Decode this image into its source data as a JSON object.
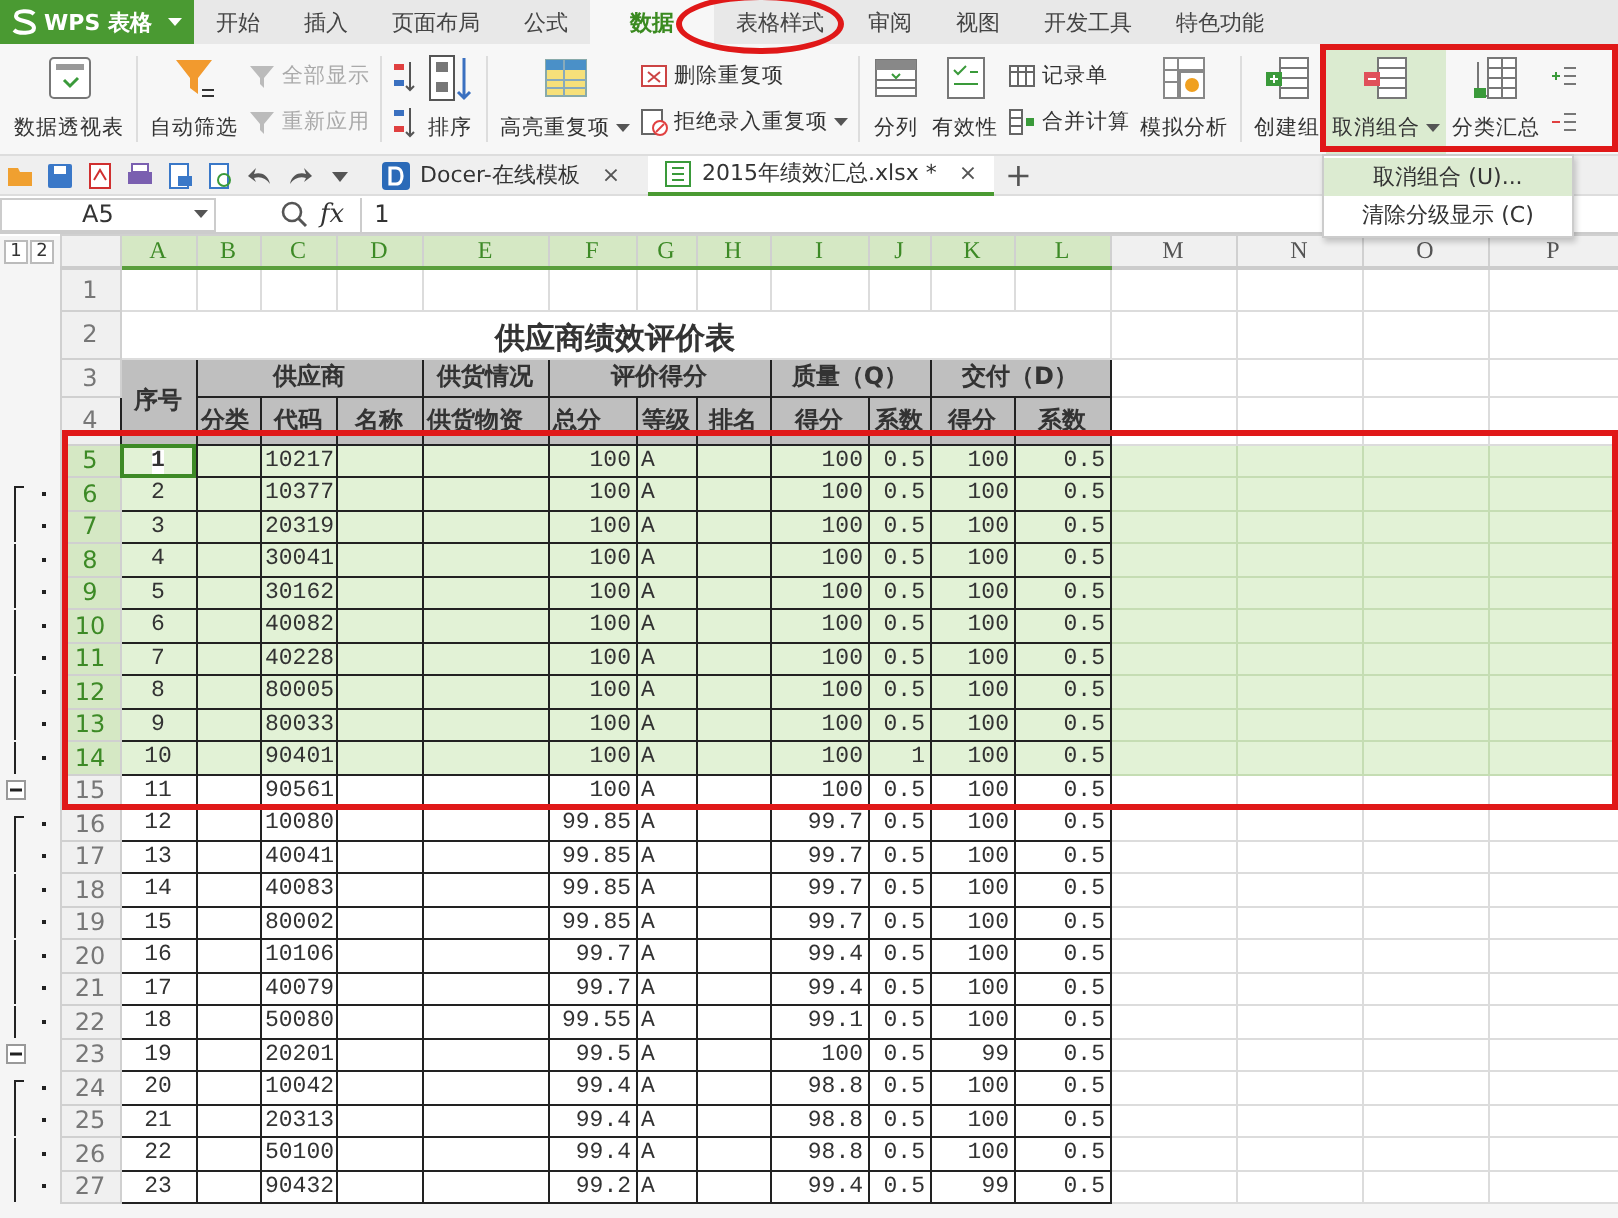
{
  "app": {
    "logo": "WPS 表格",
    "menu_tabs": [
      {
        "label": "开始",
        "selected": false
      },
      {
        "label": "插入",
        "selected": false
      },
      {
        "label": "页面布局",
        "selected": false
      },
      {
        "label": "公式",
        "selected": false
      },
      {
        "label": "数据",
        "selected": true
      },
      {
        "label": "表格样式",
        "selected": false
      },
      {
        "label": "审阅",
        "selected": false
      },
      {
        "label": "视图",
        "selected": false
      },
      {
        "label": "开发工具",
        "selected": false
      },
      {
        "label": "特色功能",
        "selected": false
      }
    ]
  },
  "ribbon": [
    {
      "kind": "large",
      "label": "数据透视表",
      "dropdown": false,
      "pressed": false
    },
    {
      "kind": "separator"
    },
    {
      "kind": "large",
      "label": "自动筛选",
      "dropdown": false,
      "pressed": false
    },
    {
      "kind": "stack",
      "items": [
        {
          "label": "全部显示",
          "disabled": true,
          "dropdown": false
        },
        {
          "label": "重新应用",
          "disabled": true,
          "dropdown": false
        }
      ]
    },
    {
      "kind": "separator"
    },
    {
      "kind": "sort",
      "label": "排序"
    },
    {
      "kind": "separator"
    },
    {
      "kind": "large",
      "label": "高亮重复项",
      "dropdown": true,
      "pressed": false
    },
    {
      "kind": "stack",
      "items": [
        {
          "label": "删除重复项",
          "disabled": false,
          "dropdown": false
        },
        {
          "label": "拒绝录入重复项",
          "disabled": false,
          "dropdown": true
        }
      ]
    },
    {
      "kind": "separator"
    },
    {
      "kind": "large",
      "label": "分列",
      "dropdown": false,
      "pressed": false
    },
    {
      "kind": "large",
      "label": "有效性",
      "dropdown": false,
      "pressed": false
    },
    {
      "kind": "stack",
      "items": [
        {
          "label": "记录单",
          "disabled": false,
          "dropdown": false
        },
        {
          "label": "合并计算",
          "disabled": false,
          "dropdown": false
        }
      ]
    },
    {
      "kind": "large",
      "label": "模拟分析",
      "dropdown": false,
      "pressed": false
    },
    {
      "kind": "separator"
    },
    {
      "kind": "large",
      "label": "创建组",
      "dropdown": false,
      "pressed": false
    },
    {
      "kind": "large",
      "label": "取消组合",
      "dropdown": true,
      "pressed": true
    },
    {
      "kind": "large",
      "label": "分类汇总",
      "dropdown": false,
      "pressed": false
    },
    {
      "kind": "detail"
    }
  ],
  "dropdown_menu": [
    {
      "label": "取消组合 (U)...",
      "selected": true
    },
    {
      "label": "清除分级显示 (C)",
      "selected": false
    }
  ],
  "doc_tabs": [
    {
      "label": "Docer-在线模板",
      "selected": false,
      "close": "×"
    },
    {
      "label": "2015年绩效汇总.xlsx *",
      "selected": true,
      "close": "×"
    }
  ],
  "new_tab": "+",
  "formula_bar": {
    "name_box": "A5",
    "fx": "fx",
    "value": "1"
  },
  "sheet": {
    "outline_levels": [
      "1",
      "2"
    ],
    "columns": [
      {
        "label": "A",
        "selected": true
      },
      {
        "label": "B",
        "selected": true
      },
      {
        "label": "C",
        "selected": true
      },
      {
        "label": "D",
        "selected": true
      },
      {
        "label": "E",
        "selected": true
      },
      {
        "label": "F",
        "selected": true
      },
      {
        "label": "G",
        "selected": true
      },
      {
        "label": "H",
        "selected": true
      },
      {
        "label": "I",
        "selected": true
      },
      {
        "label": "J",
        "selected": true
      },
      {
        "label": "K",
        "selected": true
      },
      {
        "label": "L",
        "selected": true
      },
      {
        "label": "M",
        "selected": false
      },
      {
        "label": "N",
        "selected": false
      },
      {
        "label": "O",
        "selected": false
      },
      {
        "label": "P",
        "selected": false
      }
    ],
    "top_rows": [
      {
        "number": "1",
        "selected": false
      },
      {
        "number": "2",
        "selected": false,
        "title": "供应商绩效评价表"
      }
    ],
    "header_rows": [
      {
        "number": "3",
        "selected": false
      },
      {
        "number": "4",
        "selected": false
      }
    ],
    "header_groups": [
      {
        "label": "序号"
      },
      {
        "label": "供应商",
        "columns": [
          "分类",
          "代码",
          "名称"
        ]
      },
      {
        "label": "供货情况",
        "columns": [
          "供货物资"
        ]
      },
      {
        "label": "评价得分",
        "columns": [
          "总分",
          "等级",
          "排名"
        ]
      },
      {
        "label": "质量（Q）",
        "columns": [
          "得分",
          "系数"
        ]
      },
      {
        "label": "交付（D）",
        "columns": [
          "得分",
          "系数"
        ]
      }
    ],
    "rows": [
      {
        "number": "5",
        "selected": true,
        "active": true,
        "grouped": false,
        "collapse": false,
        "no": "1",
        "code": "10217",
        "total": "100",
        "grade": "A",
        "q_score": "100",
        "q_coef": "0.5",
        "d_score": "100",
        "d_coef": "0.5"
      },
      {
        "number": "6",
        "selected": true,
        "active": false,
        "grouped": true,
        "collapse": false,
        "no": "2",
        "code": "10377",
        "total": "100",
        "grade": "A",
        "q_score": "100",
        "q_coef": "0.5",
        "d_score": "100",
        "d_coef": "0.5"
      },
      {
        "number": "7",
        "selected": true,
        "active": false,
        "grouped": true,
        "collapse": false,
        "no": "3",
        "code": "20319",
        "total": "100",
        "grade": "A",
        "q_score": "100",
        "q_coef": "0.5",
        "d_score": "100",
        "d_coef": "0.5"
      },
      {
        "number": "8",
        "selected": true,
        "active": false,
        "grouped": true,
        "collapse": false,
        "no": "4",
        "code": "30041",
        "total": "100",
        "grade": "A",
        "q_score": "100",
        "q_coef": "0.5",
        "d_score": "100",
        "d_coef": "0.5"
      },
      {
        "number": "9",
        "selected": true,
        "active": false,
        "grouped": true,
        "collapse": false,
        "no": "5",
        "code": "30162",
        "total": "100",
        "grade": "A",
        "q_score": "100",
        "q_coef": "0.5",
        "d_score": "100",
        "d_coef": "0.5"
      },
      {
        "number": "10",
        "selected": true,
        "active": false,
        "grouped": true,
        "collapse": false,
        "no": "6",
        "code": "40082",
        "total": "100",
        "grade": "A",
        "q_score": "100",
        "q_coef": "0.5",
        "d_score": "100",
        "d_coef": "0.5"
      },
      {
        "number": "11",
        "selected": true,
        "active": false,
        "grouped": true,
        "collapse": false,
        "no": "7",
        "code": "40228",
        "total": "100",
        "grade": "A",
        "q_score": "100",
        "q_coef": "0.5",
        "d_score": "100",
        "d_coef": "0.5"
      },
      {
        "number": "12",
        "selected": true,
        "active": false,
        "grouped": true,
        "collapse": false,
        "no": "8",
        "code": "80005",
        "total": "100",
        "grade": "A",
        "q_score": "100",
        "q_coef": "0.5",
        "d_score": "100",
        "d_coef": "0.5"
      },
      {
        "number": "13",
        "selected": true,
        "active": false,
        "grouped": true,
        "collapse": false,
        "no": "9",
        "code": "80033",
        "total": "100",
        "grade": "A",
        "q_score": "100",
        "q_coef": "0.5",
        "d_score": "100",
        "d_coef": "0.5"
      },
      {
        "number": "14",
        "selected": true,
        "active": false,
        "grouped": true,
        "collapse": false,
        "no": "10",
        "code": "90401",
        "total": "100",
        "grade": "A",
        "q_score": "100",
        "q_coef": "1",
        "d_score": "100",
        "d_coef": "0.5"
      },
      {
        "number": "15",
        "selected": false,
        "active": false,
        "grouped": false,
        "collapse": true,
        "no": "11",
        "code": "90561",
        "total": "100",
        "grade": "A",
        "q_score": "100",
        "q_coef": "0.5",
        "d_score": "100",
        "d_coef": "0.5"
      },
      {
        "number": "16",
        "selected": false,
        "active": false,
        "grouped": true,
        "collapse": false,
        "no": "12",
        "code": "10080",
        "total": "99.85",
        "grade": "A",
        "q_score": "99.7",
        "q_coef": "0.5",
        "d_score": "100",
        "d_coef": "0.5"
      },
      {
        "number": "17",
        "selected": false,
        "active": false,
        "grouped": true,
        "collapse": false,
        "no": "13",
        "code": "40041",
        "total": "99.85",
        "grade": "A",
        "q_score": "99.7",
        "q_coef": "0.5",
        "d_score": "100",
        "d_coef": "0.5"
      },
      {
        "number": "18",
        "selected": false,
        "active": false,
        "grouped": true,
        "collapse": false,
        "no": "14",
        "code": "40083",
        "total": "99.85",
        "grade": "A",
        "q_score": "99.7",
        "q_coef": "0.5",
        "d_score": "100",
        "d_coef": "0.5"
      },
      {
        "number": "19",
        "selected": false,
        "active": false,
        "grouped": true,
        "collapse": false,
        "no": "15",
        "code": "80002",
        "total": "99.85",
        "grade": "A",
        "q_score": "99.7",
        "q_coef": "0.5",
        "d_score": "100",
        "d_coef": "0.5"
      },
      {
        "number": "20",
        "selected": false,
        "active": false,
        "grouped": true,
        "collapse": false,
        "no": "16",
        "code": "10106",
        "total": "99.7",
        "grade": "A",
        "q_score": "99.4",
        "q_coef": "0.5",
        "d_score": "100",
        "d_coef": "0.5"
      },
      {
        "number": "21",
        "selected": false,
        "active": false,
        "grouped": true,
        "collapse": false,
        "no": "17",
        "code": "40079",
        "total": "99.7",
        "grade": "A",
        "q_score": "99.4",
        "q_coef": "0.5",
        "d_score": "100",
        "d_coef": "0.5"
      },
      {
        "number": "22",
        "selected": false,
        "active": false,
        "grouped": true,
        "collapse": false,
        "no": "18",
        "code": "50080",
        "total": "99.55",
        "grade": "A",
        "q_score": "99.1",
        "q_coef": "0.5",
        "d_score": "100",
        "d_coef": "0.5"
      },
      {
        "number": "23",
        "selected": false,
        "active": false,
        "grouped": false,
        "collapse": true,
        "no": "19",
        "code": "20201",
        "total": "99.5",
        "grade": "A",
        "q_score": "100",
        "q_coef": "0.5",
        "d_score": "99",
        "d_coef": "0.5"
      },
      {
        "number": "24",
        "selected": false,
        "active": false,
        "grouped": true,
        "collapse": false,
        "no": "20",
        "code": "10042",
        "total": "99.4",
        "grade": "A",
        "q_score": "98.8",
        "q_coef": "0.5",
        "d_score": "100",
        "d_coef": "0.5"
      },
      {
        "number": "25",
        "selected": false,
        "active": false,
        "grouped": true,
        "collapse": false,
        "no": "21",
        "code": "20313",
        "total": "99.4",
        "grade": "A",
        "q_score": "98.8",
        "q_coef": "0.5",
        "d_score": "100",
        "d_coef": "0.5"
      },
      {
        "number": "26",
        "selected": false,
        "active": false,
        "grouped": true,
        "collapse": false,
        "no": "22",
        "code": "50100",
        "total": "99.4",
        "grade": "A",
        "q_score": "98.8",
        "q_coef": "0.5",
        "d_score": "100",
        "d_coef": "0.5"
      },
      {
        "number": "27",
        "selected": false,
        "active": false,
        "grouped": true,
        "collapse": false,
        "no": "23",
        "code": "90432",
        "total": "99.2",
        "grade": "A",
        "q_score": "99.4",
        "q_coef": "0.5",
        "d_score": "99",
        "d_coef": "0.5"
      }
    ]
  }
}
